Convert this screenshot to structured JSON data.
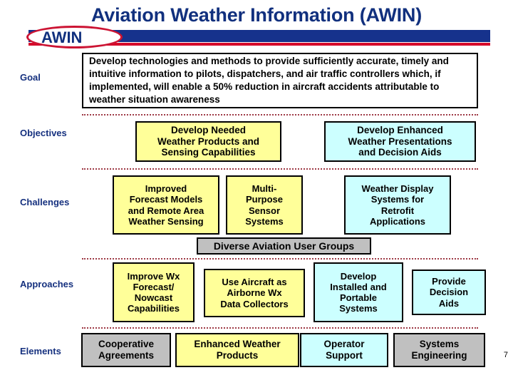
{
  "header": {
    "title": "Aviation Weather Information (AWIN)",
    "badge": "AWIN",
    "bar_color": "#16328c",
    "rule_color": "#d6082a",
    "ellipse_color": "#cc1433",
    "title_color": "#11307e"
  },
  "rows": {
    "goal": {
      "label": "Goal",
      "text": "Develop technologies and methods to provide sufficiently accurate, timely and intuitive information to pilots, dispatchers, and air traffic controllers which, if implemented, will enable a 50% reduction in aircraft accidents attributable to weather situation awareness"
    },
    "objectives": {
      "label": "Objectives",
      "boxes": [
        {
          "lines": [
            "Develop Needed",
            "Weather Products and",
            "Sensing Capabilities"
          ],
          "color": "#ffff99"
        },
        {
          "lines": [
            "Develop Enhanced",
            "Weather Presentations",
            "and Decision Aids"
          ],
          "color": "#ccffff"
        }
      ]
    },
    "challenges": {
      "label": "Challenges",
      "boxes": [
        {
          "lines": [
            "Improved",
            "Forecast Models",
            "and Remote Area",
            "Weather Sensing"
          ],
          "color": "#ffff99"
        },
        {
          "lines": [
            "Multi-",
            "Purpose",
            "Sensor",
            "Systems"
          ],
          "color": "#ffff99"
        },
        {
          "lines": [
            "Weather Display",
            "Systems for",
            "Retrofit",
            "Applications"
          ],
          "color": "#ccffff"
        }
      ]
    },
    "user_groups": {
      "text": "Diverse Aviation User Groups",
      "color": "#c0c0c0"
    },
    "approaches": {
      "label": "Approaches",
      "boxes": [
        {
          "lines": [
            "Improve Wx",
            "Forecast/",
            "Nowcast",
            "Capabilities"
          ],
          "color": "#ffff99"
        },
        {
          "lines": [
            "Use Aircraft as",
            "Airborne Wx",
            "Data Collectors"
          ],
          "color": "#ffff99"
        },
        {
          "lines": [
            "Develop",
            "Installed and",
            "Portable",
            "Systems"
          ],
          "color": "#ccffff"
        },
        {
          "lines": [
            "Provide",
            "Decision",
            "Aids"
          ],
          "color": "#ccffff"
        }
      ]
    },
    "elements": {
      "label": "Elements",
      "boxes": [
        {
          "lines": [
            "Cooperative",
            "Agreements"
          ],
          "color": "#c0c0c0"
        },
        {
          "lines": [
            "Enhanced Weather",
            "Products"
          ],
          "color": "#ffff99"
        },
        {
          "lines": [
            "Operator",
            "Support"
          ],
          "color": "#ccffff"
        },
        {
          "lines": [
            "Systems",
            "Engineering"
          ],
          "color": "#c0c0c0"
        }
      ]
    }
  },
  "footer": {
    "page_number": "7"
  }
}
